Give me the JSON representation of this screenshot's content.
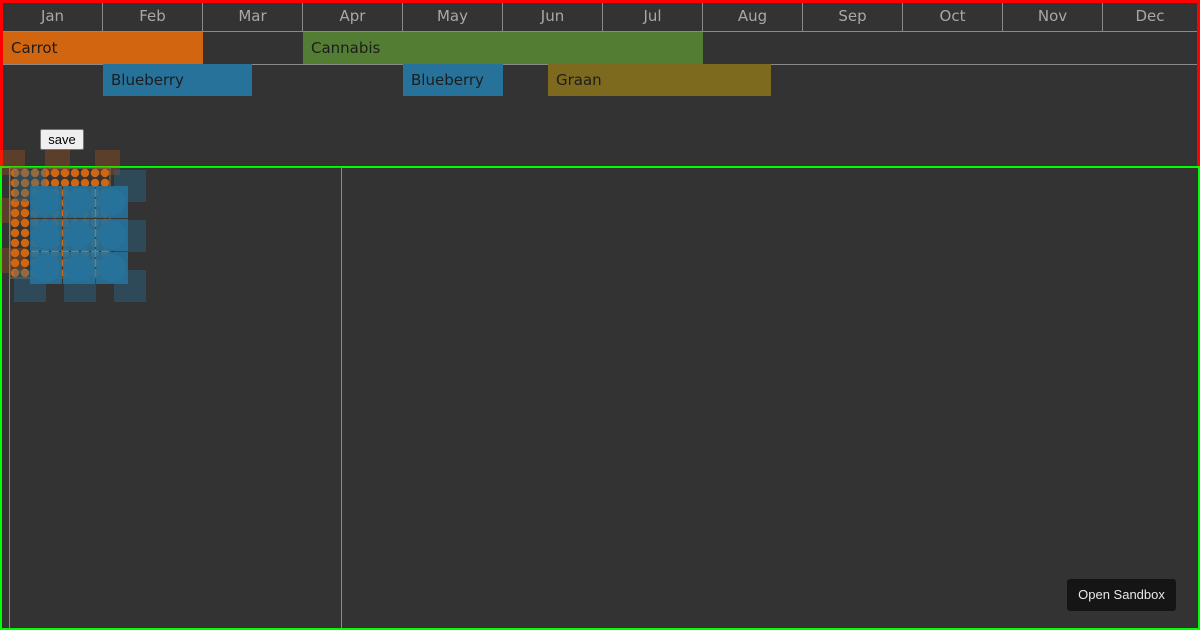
{
  "timeline": {
    "months": [
      "Jan",
      "Feb",
      "Mar",
      "Apr",
      "May",
      "Jun",
      "Jul",
      "Aug",
      "Sep",
      "Oct",
      "Nov",
      "Dec"
    ],
    "crops": [
      {
        "label": "Carrot",
        "color": "#d2650f"
      },
      {
        "label": "Cannabis",
        "color": "#527d32"
      },
      {
        "label": "Blueberry",
        "color": "#26729a"
      },
      {
        "label": "Blueberry",
        "color": "#26729a"
      },
      {
        "label": "Graan",
        "color": "#7d6a1e"
      }
    ]
  },
  "toolbar": {
    "save_label": "save"
  },
  "garden": {
    "plant_colors": {
      "carrot": "#d2650f",
      "blueberry": "#26729a"
    }
  },
  "sandbox": {
    "button_label": "Open Sandbox"
  },
  "colors": {
    "timeline_border": "#ff0000",
    "garden_border": "#00ff00",
    "background": "#333333"
  }
}
